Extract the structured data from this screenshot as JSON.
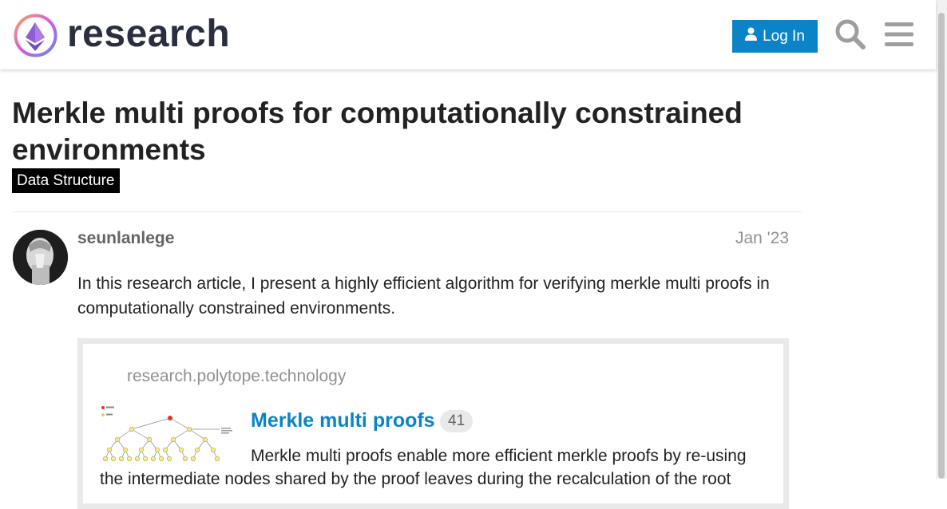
{
  "header": {
    "logo_text": "research",
    "login_label": "Log In",
    "icons": [
      "ethereum-logo-icon",
      "user-icon",
      "search-icon",
      "hamburger-menu-icon"
    ]
  },
  "topic": {
    "title": "Merkle multi proofs for computationally constrained environments",
    "category": "Data Structure"
  },
  "post": {
    "username": "seunlanlege",
    "date": "Jan '23",
    "body": "In this research article, I present a highly efficient algorithm for verifying merkle multi proofs in computationally constrained environments."
  },
  "onebox": {
    "source": "research.polytope.technology",
    "title": "Merkle multi proofs",
    "count": "41",
    "description": "Merkle multi proofs enable more efficient merkle proofs by re-using the intermediate nodes shared by the proof leaves during the recalculation of the root"
  },
  "colors": {
    "accent": "#0a84c6",
    "category_bg": "#000000",
    "muted_text": "#919191"
  }
}
